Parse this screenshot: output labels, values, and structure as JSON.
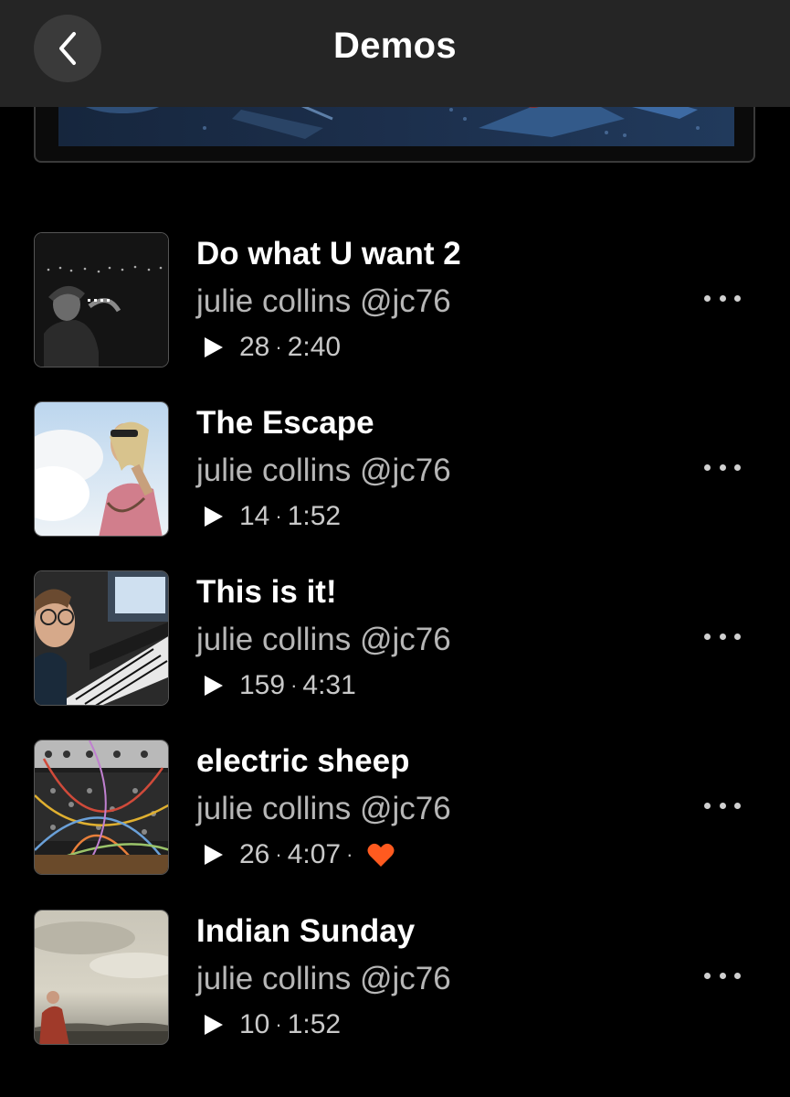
{
  "header": {
    "title": "Demos",
    "back_icon": "chevron-left-icon"
  },
  "tracks": [
    {
      "title": "Do what U want 2",
      "artist": "julie collins @jc76",
      "plays": "28",
      "duration": "2:40",
      "liked": false
    },
    {
      "title": "The Escape",
      "artist": "julie collins @jc76",
      "plays": "14",
      "duration": "1:52",
      "liked": false
    },
    {
      "title": "This is it!",
      "artist": "julie collins @jc76",
      "plays": "159",
      "duration": "4:31",
      "liked": false
    },
    {
      "title": "electric sheep",
      "artist": "julie collins @jc76",
      "plays": "26",
      "duration": "4:07",
      "liked": true
    },
    {
      "title": "Indian Sunday",
      "artist": "julie collins @jc76",
      "plays": "10",
      "duration": "1:52",
      "liked": false
    }
  ],
  "colors": {
    "background": "#000000",
    "header": "#252525",
    "heart": "#ff5a1f",
    "secondary_text": "#b6b6b6"
  },
  "icons": {
    "play": "play-icon",
    "more": "more-options-icon",
    "heart": "heart-icon"
  }
}
